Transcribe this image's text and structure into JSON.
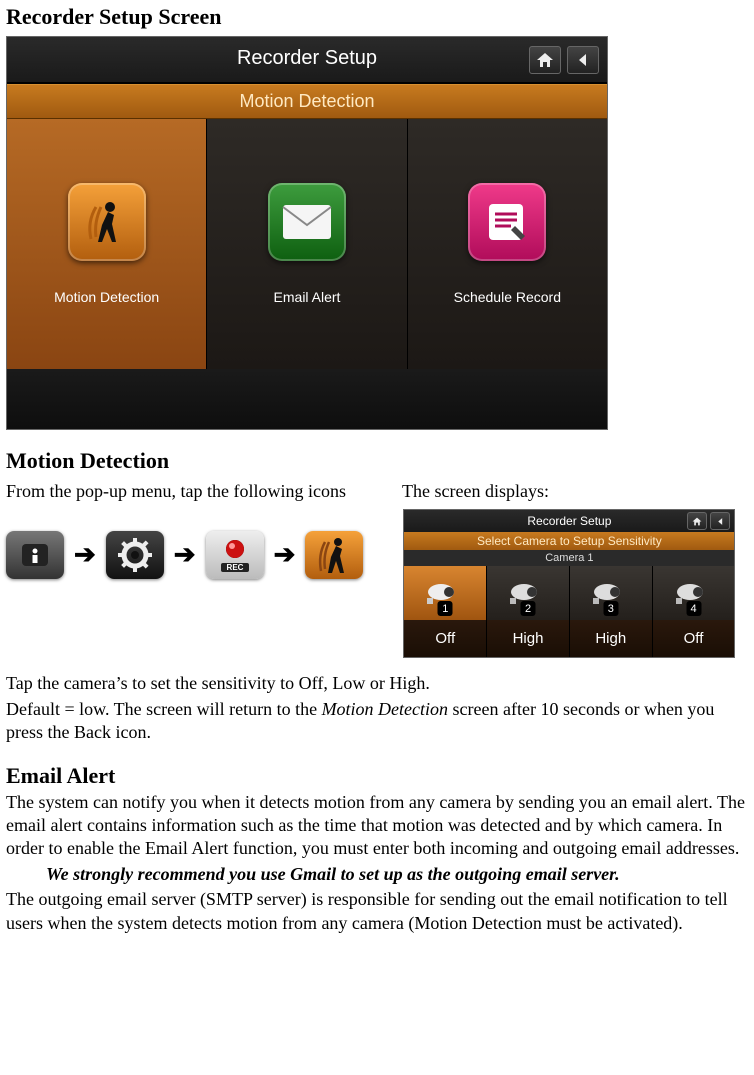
{
  "headings": {
    "recorder_setup": "Recorder Setup Screen",
    "motion_detection": "Motion Detection",
    "email_alert": "Email Alert"
  },
  "setup_screen": {
    "title": "Recorder Setup",
    "subtitle": "Motion Detection",
    "tiles": [
      "Motion Detection",
      "Email Alert",
      "Schedule Record"
    ]
  },
  "motion": {
    "left_intro": "From the pop-up menu, tap the following icons",
    "right_intro": "The screen displays:",
    "arrow": "➔",
    "sens_screen": {
      "title": "Recorder Setup",
      "subtitle": "Select Camera to Setup Sensitivity",
      "camera_label": "Camera 1",
      "cells": [
        {
          "id": "1",
          "value": "Off",
          "selected": true
        },
        {
          "id": "2",
          "value": "High",
          "selected": false
        },
        {
          "id": "3",
          "value": "High",
          "selected": false
        },
        {
          "id": "4",
          "value": "Off",
          "selected": false
        }
      ]
    },
    "paragraph1": "Tap the camera’s to set the sensitivity to Off, Low or High.",
    "paragraph2_a": "Default = low. The screen will return to the ",
    "paragraph2_em": "Motion Detection",
    "paragraph2_b": " screen after 10 seconds or when you press the Back icon."
  },
  "email": {
    "paragraph1": "The system can notify you when it detects motion from any camera by sending you an email alert. The email alert contains information such as the time that motion was detected and by which camera. In order to enable the Email Alert function, you must enter both incoming and outgoing email addresses.",
    "recommend": "We strongly recommend you use Gmail to set up as the outgoing email server.",
    "paragraph2": "The outgoing email server (SMTP server) is responsible for sending out the email notification to tell users when the system detects motion from any camera (Motion Detection must be activated)."
  }
}
